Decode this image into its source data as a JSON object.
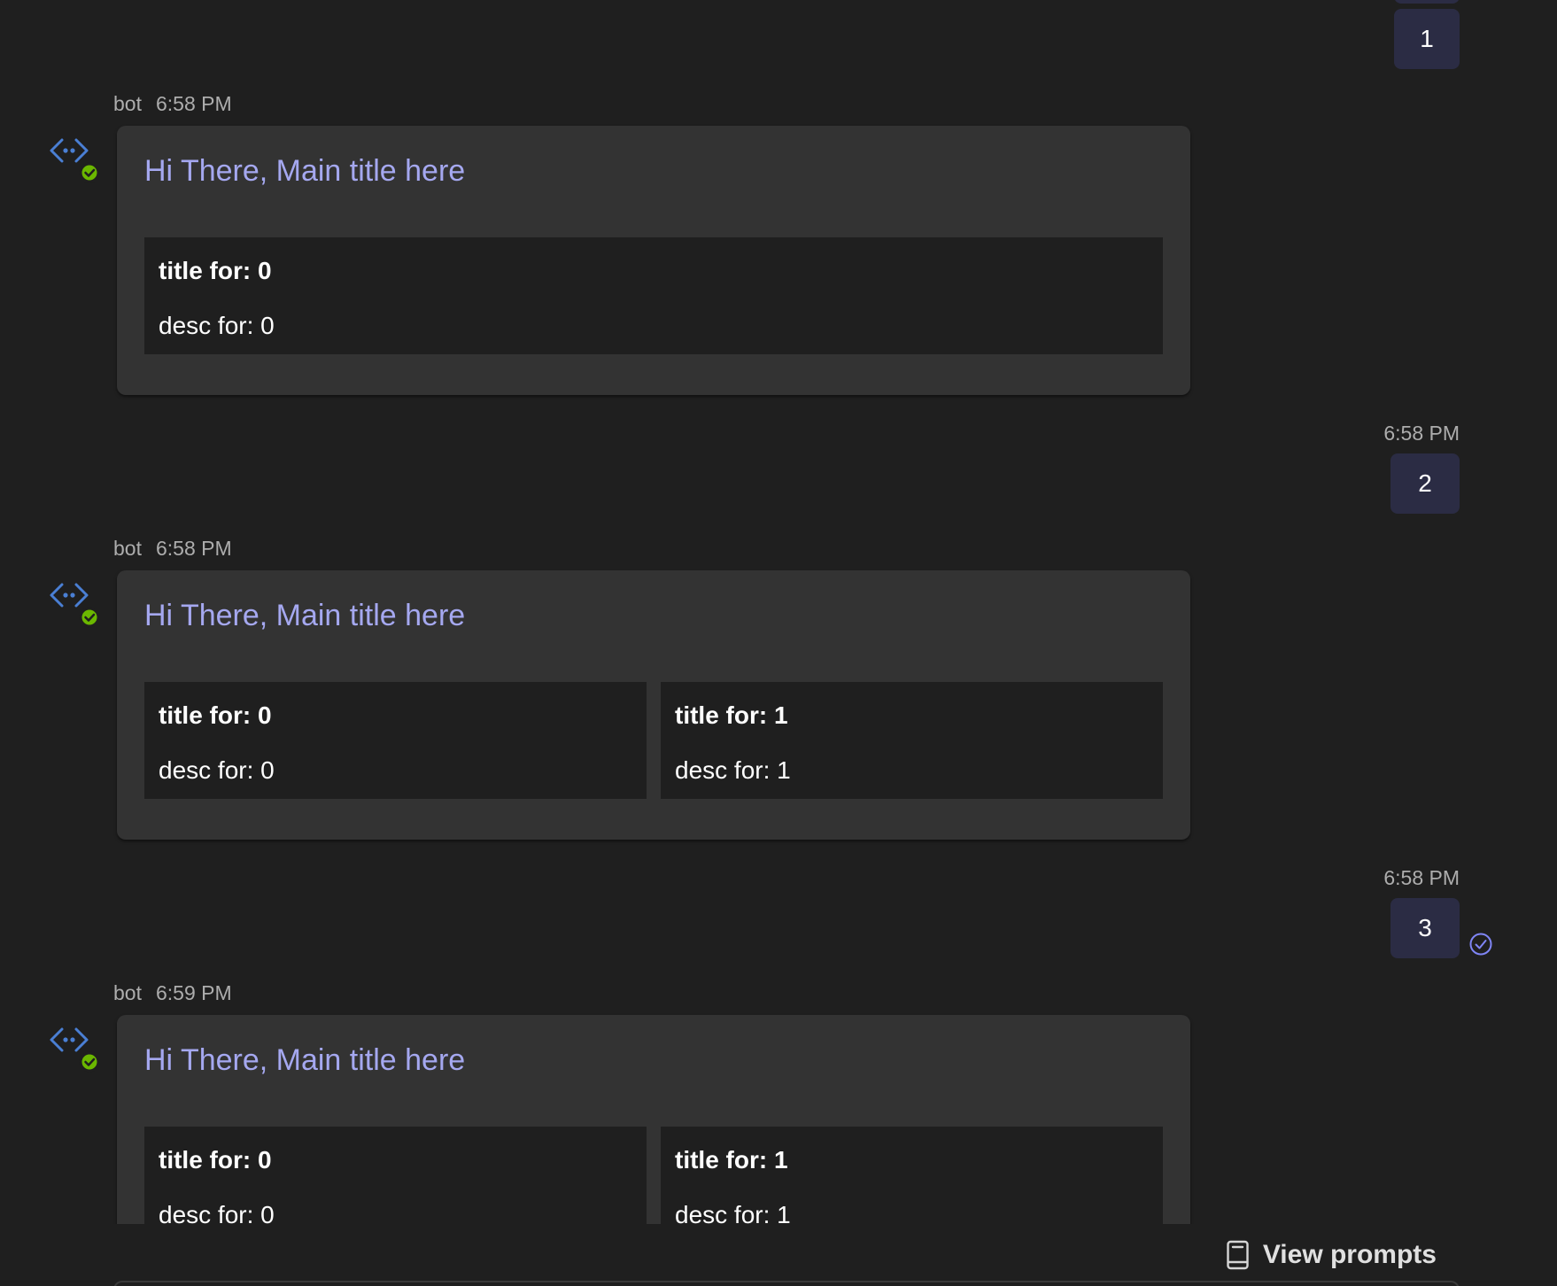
{
  "messages": [
    {
      "type": "user",
      "text": "1",
      "time": ""
    },
    {
      "type": "bot",
      "sender": "bot",
      "time": "6:58 PM",
      "title": "Hi There, Main title here",
      "items": [
        {
          "title": "title for: 0",
          "desc": "desc for: 0"
        }
      ]
    },
    {
      "type": "user",
      "text": "2",
      "time": "6:58 PM"
    },
    {
      "type": "bot",
      "sender": "bot",
      "time": "6:58 PM",
      "title": "Hi There, Main title here",
      "items": [
        {
          "title": "title for: 0",
          "desc": "desc for: 0"
        },
        {
          "title": "title for: 1",
          "desc": "desc for: 1"
        }
      ]
    },
    {
      "type": "user",
      "text": "3",
      "time": "6:58 PM",
      "status": "read"
    },
    {
      "type": "bot",
      "sender": "bot",
      "time": "6:59 PM",
      "title": "Hi There, Main title here",
      "items": [
        {
          "title": "title for: 0",
          "desc": "desc for: 0"
        },
        {
          "title": "title for: 1",
          "desc": "desc for: 1"
        }
      ]
    }
  ],
  "footer": {
    "view_prompts_label": "View prompts",
    "icon": "book-icon"
  },
  "colors": {
    "background": "#1f1f1f",
    "card": "#333333",
    "user_bubble": "#2b2c44",
    "card_title": "#a5a8f0",
    "bot_icon": "#4a7fd4",
    "online_badge": "#6bb700",
    "read_status": "#7f85f5"
  }
}
